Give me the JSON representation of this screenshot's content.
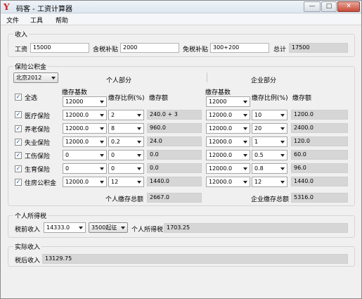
{
  "window": {
    "title": "码客 - 工资计算器",
    "icon": "Y",
    "min_label": "—",
    "max_label": "□",
    "close_label": "✕"
  },
  "menu": [
    "文件",
    "工具",
    "帮助"
  ],
  "income": {
    "group_title": "收入",
    "salary_label": "工资",
    "salary_value": "15000",
    "taxable_allowance_label": "含税补贴",
    "taxable_allowance_value": "2000",
    "taxfree_allowance_label": "免税补贴",
    "taxfree_allowance_value": "300+200",
    "total_label": "总计",
    "total_value": "17500"
  },
  "fund": {
    "group_title": "保险公积金",
    "city": "北京2012",
    "personal_title": "个人部分",
    "company_title": "企业部分",
    "select_all_label": "全选",
    "base_header": "缴存基数",
    "ratio_header": "缴存比例(%)",
    "amount_header": "缴存额",
    "personal_base": "12000",
    "company_base": "12000",
    "rows": [
      {
        "name": "医疗保险",
        "p_base": "12000.0",
        "p_ratio": "2",
        "p_amount": "240.0 + 3",
        "c_base": "12000.0",
        "c_ratio": "10",
        "c_amount": "1200.0"
      },
      {
        "name": "养老保险",
        "p_base": "12000.0",
        "p_ratio": "8",
        "p_amount": "960.0",
        "c_base": "12000.0",
        "c_ratio": "20",
        "c_amount": "2400.0"
      },
      {
        "name": "失业保险",
        "p_base": "12000.0",
        "p_ratio": "0.2",
        "p_amount": "24.0",
        "c_base": "12000.0",
        "c_ratio": "1",
        "c_amount": "120.0"
      },
      {
        "name": "工伤保险",
        "p_base": "0",
        "p_ratio": "0",
        "p_amount": "0.0",
        "c_base": "12000.0",
        "c_ratio": "0.5",
        "c_amount": "60.0"
      },
      {
        "name": "生育保险",
        "p_base": "0",
        "p_ratio": "0",
        "p_amount": "0.0",
        "c_base": "12000.0",
        "c_ratio": "0.8",
        "c_amount": "96.0"
      },
      {
        "name": "住房公积金",
        "p_base": "12000.0",
        "p_ratio": "12",
        "p_amount": "1440.0",
        "c_base": "12000.0",
        "c_ratio": "12",
        "c_amount": "1440.0"
      }
    ],
    "personal_total_label": "个人缴存总额",
    "personal_total_value": "2667.0",
    "company_total_label": "企业缴存总额",
    "company_total_value": "5316.0"
  },
  "tax": {
    "group_title": "个人所得税",
    "pretax_label": "税前收入",
    "pretax_value": "14333.0",
    "threshold": "3500起征",
    "tax_label": "个人所得税",
    "tax_value": "1703.25"
  },
  "actual": {
    "group_title": "实际收入",
    "aftertax_label": "税后收入",
    "aftertax_value": "13129.75"
  }
}
